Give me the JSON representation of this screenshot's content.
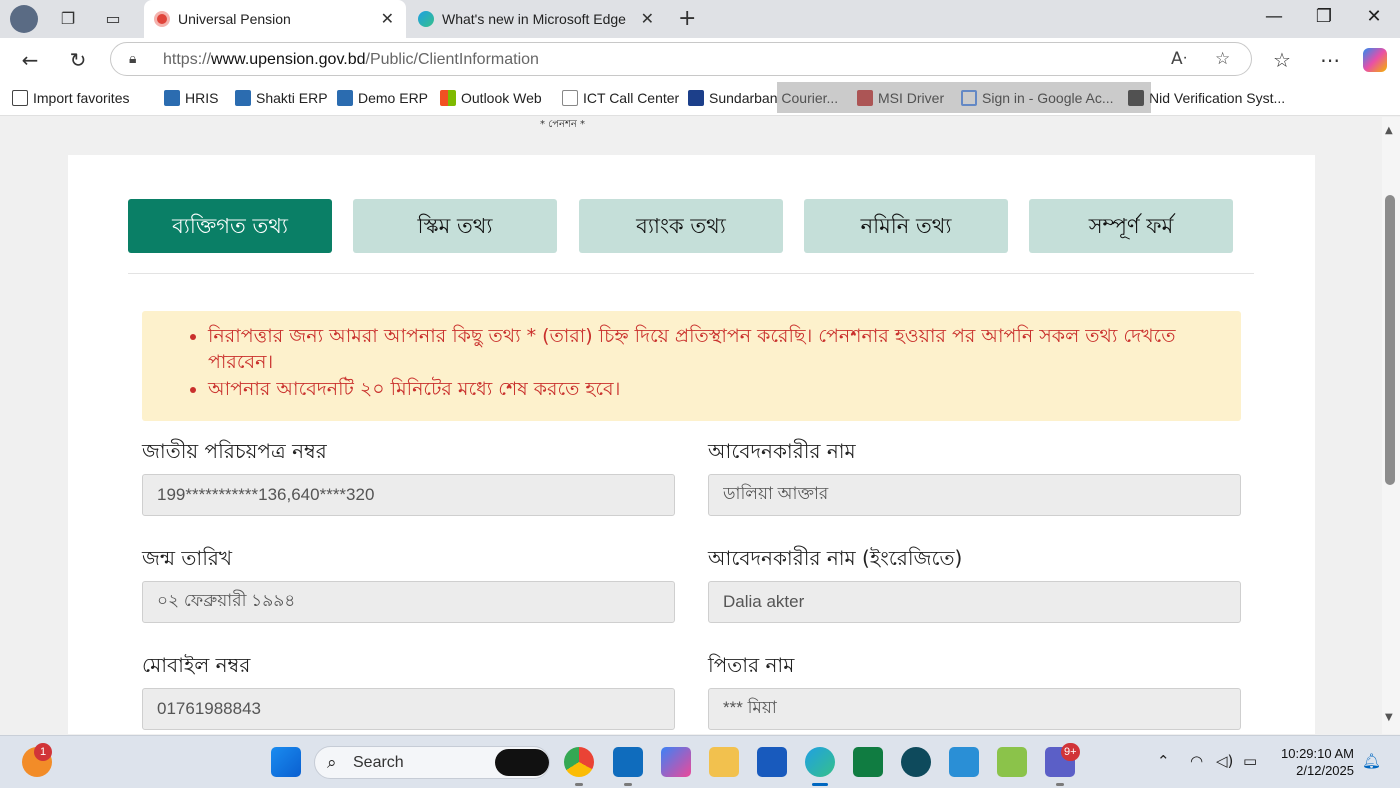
{
  "browser": {
    "tabs": [
      {
        "title": "Universal Pension",
        "active": true
      },
      {
        "title": "What's new in Microsoft Edge",
        "active": false
      }
    ],
    "url_prefix": "https://",
    "url_host": "www.upension.gov.bd",
    "url_path": "/Public/ClientInformation",
    "bookmarks": [
      "Import favorites",
      "HRIS",
      "Shakti ERP",
      "Demo ERP",
      "Outlook Web",
      "ICT Call Center",
      "Sundarban Courier...",
      "MSI Driver",
      "Sign in - Google Ac...",
      "Nid Verification Syst..."
    ]
  },
  "page": {
    "top_text": "* পেনশন *",
    "steps": [
      "ব্যক্তিগত তথ্য",
      "স্কিম তথ্য",
      "ব্যাংক তথ্য",
      "নমিনি তথ্য",
      "সম্পূর্ণ ফর্ম"
    ],
    "alerts": [
      "নিরাপত্তার জন্য আমরা আপনার কিছু তথ্য * (তারা) চিহ্ন দিয়ে প্রতিস্থাপন করেছি। পেনশনার হওয়ার পর আপনি সকল তথ্য দেখতে পারবেন।",
      "আপনার আবেদনটি ২০ মিনিটের মধ্যে শেষ করতে হবে।"
    ],
    "fields": {
      "nid": {
        "label": "জাতীয় পরিচয়পত্র নম্বর",
        "value": "199***********136,640****320"
      },
      "applicant_name": {
        "label": "আবেদনকারীর নাম",
        "value": "ডালিয়া আক্তার"
      },
      "dob": {
        "label": "জন্ম তারিখ",
        "value": "০২ ফেব্রুয়ারী ১৯৯৪"
      },
      "applicant_name_en": {
        "label": "আবেদনকারীর নাম (ইংরেজিতে)",
        "value": "Dalia akter"
      },
      "mobile": {
        "label": "মোবাইল নম্বর",
        "value": "01761988843"
      },
      "father_name": {
        "label": "পিতার নাম",
        "value": "*** মিয়া"
      }
    }
  },
  "taskbar": {
    "search_label": "Search",
    "notification_badge": "1",
    "teams_badge": "9+",
    "time": "10:29:10 AM",
    "date": "2/12/2025"
  },
  "colors": {
    "step_active": "#0a7f66",
    "step_inactive": "#c5dfd9",
    "alert_bg": "#fdf1cc",
    "alert_text": "#c9302c"
  }
}
